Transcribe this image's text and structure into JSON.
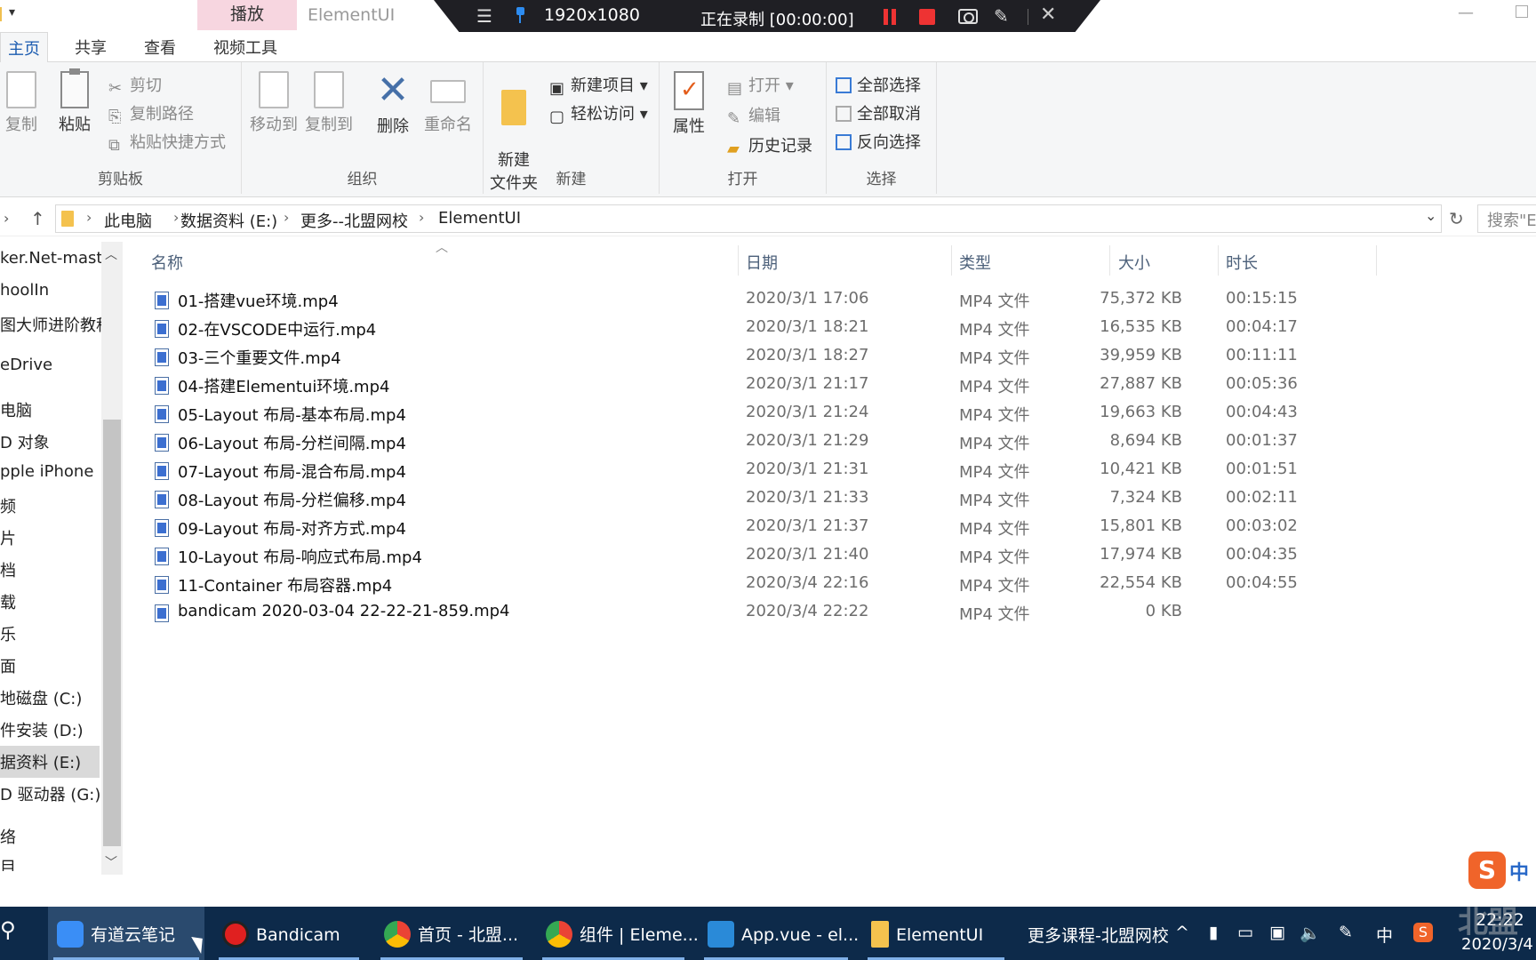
{
  "titlebar": {
    "context_tab": "播放",
    "window_title": "ElementUI"
  },
  "recorder": {
    "resolution": "1920x1080",
    "status": "正在录制 [00:00:00]"
  },
  "menu_tabs": [
    "主页",
    "共享",
    "查看",
    "视频工具"
  ],
  "ribbon": {
    "clipboard": {
      "label": "剪贴板",
      "copy": "复制",
      "paste": "粘贴",
      "cut": "剪切",
      "copy_path": "复制路径",
      "paste_shortcut": "粘贴快捷方式"
    },
    "organize": {
      "label": "组织",
      "move_to": "移动到",
      "copy_to": "复制到",
      "delete": "删除",
      "rename": "重命名"
    },
    "new": {
      "label": "新建",
      "new_folder": "新建\n文件夹",
      "new_item": "新建项目",
      "easy_access": "轻松访问"
    },
    "open": {
      "label": "打开",
      "properties": "属性",
      "open": "打开",
      "edit": "编辑",
      "history": "历史记录"
    },
    "select": {
      "label": "选择",
      "select_all": "全部选择",
      "select_none": "全部取消",
      "invert": "反向选择"
    }
  },
  "address": {
    "crumbs": [
      "此电脑",
      "数据资料 (E:)",
      "更多--北盟网校",
      "ElementUI"
    ],
    "search_placeholder": "搜索\"E"
  },
  "nav_pane": {
    "items": [
      "ker.Net-mast",
      "hoolIn",
      "图大师进阶教程",
      "eDrive",
      "电脑",
      "D 对象",
      "pple iPhone",
      "频",
      "片",
      "档",
      "载",
      "乐",
      "面",
      "地磁盘 (C:)",
      "件安装 (D:)",
      "据资料 (E:)",
      "D 驱动器 (G:)",
      "络",
      "目"
    ],
    "selected_index": 15
  },
  "columns": {
    "name": "名称",
    "date": "日期",
    "type": "类型",
    "size": "大小",
    "duration": "时长"
  },
  "files": [
    {
      "name": "01-搭建vue环境.mp4",
      "date": "2020/3/1 17:06",
      "type": "MP4 文件",
      "size": "75,372 KB",
      "duration": "00:15:15"
    },
    {
      "name": "02-在VSCODE中运行.mp4",
      "date": "2020/3/1 18:21",
      "type": "MP4 文件",
      "size": "16,535 KB",
      "duration": "00:04:17"
    },
    {
      "name": "03-三个重要文件.mp4",
      "date": "2020/3/1 18:27",
      "type": "MP4 文件",
      "size": "39,959 KB",
      "duration": "00:11:11"
    },
    {
      "name": "04-搭建Elementui环境.mp4",
      "date": "2020/3/1 21:17",
      "type": "MP4 文件",
      "size": "27,887 KB",
      "duration": "00:05:36"
    },
    {
      "name": "05-Layout 布局-基本布局.mp4",
      "date": "2020/3/1 21:24",
      "type": "MP4 文件",
      "size": "19,663 KB",
      "duration": "00:04:43"
    },
    {
      "name": "06-Layout 布局-分栏间隔.mp4",
      "date": "2020/3/1 21:29",
      "type": "MP4 文件",
      "size": "8,694 KB",
      "duration": "00:01:37"
    },
    {
      "name": "07-Layout 布局-混合布局.mp4",
      "date": "2020/3/1 21:31",
      "type": "MP4 文件",
      "size": "10,421 KB",
      "duration": "00:01:51"
    },
    {
      "name": "08-Layout 布局-分栏偏移.mp4",
      "date": "2020/3/1 21:33",
      "type": "MP4 文件",
      "size": "7,324 KB",
      "duration": "00:02:11"
    },
    {
      "name": "09-Layout 布局-对齐方式.mp4",
      "date": "2020/3/1 21:37",
      "type": "MP4 文件",
      "size": "15,801 KB",
      "duration": "00:03:02"
    },
    {
      "name": "10-Layout 布局-响应式布局.mp4",
      "date": "2020/3/1 21:40",
      "type": "MP4 文件",
      "size": "17,974 KB",
      "duration": "00:04:35"
    },
    {
      "name": "11-Container 布局容器.mp4",
      "date": "2020/3/4 22:16",
      "type": "MP4 文件",
      "size": "22,554 KB",
      "duration": "00:04:55"
    },
    {
      "name": "bandicam 2020-03-04 22-22-21-859.mp4",
      "date": "2020/3/4 22:22",
      "type": "MP4 文件",
      "size": "0 KB",
      "duration": ""
    }
  ],
  "ime": {
    "logo": "S",
    "mode": "中"
  },
  "taskbar": {
    "items": [
      "有道云笔记",
      "Bandicam",
      "首页 - 北盟...",
      "组件 | Eleme...",
      "App.vue - el...",
      "ElementUI"
    ],
    "tray_text": "更多课程-北盟网校",
    "ime_indicator": "中",
    "clock_time": "22:22",
    "clock_date": "2020/3/4"
  },
  "watermark": "北盟"
}
